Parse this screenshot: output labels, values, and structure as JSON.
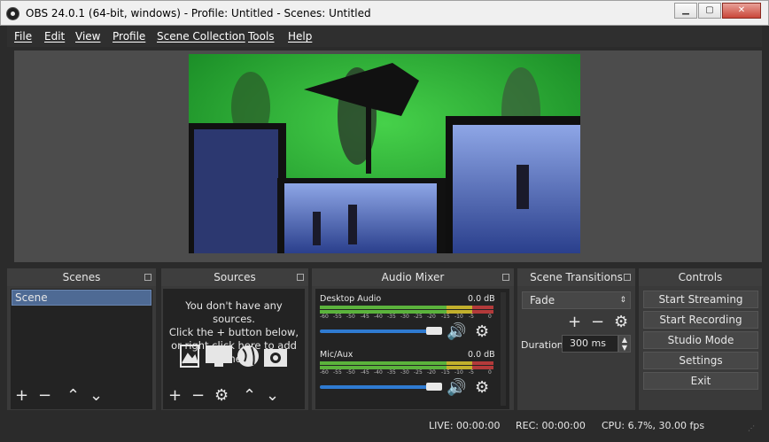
{
  "window": {
    "title": "OBS 24.0.1 (64-bit, windows) - Profile: Untitled - Scenes: Untitled"
  },
  "menu": [
    "File",
    "Edit",
    "View",
    "Profile",
    "Scene Collection",
    "Tools",
    "Help"
  ],
  "docks": {
    "scenes": {
      "title": "Scenes",
      "items": [
        "Scene"
      ]
    },
    "sources": {
      "title": "Sources",
      "empty_text_1": "You don't have any sources.",
      "empty_text_2": "Click the + button below,",
      "empty_text_3": "or right click here to add one."
    },
    "mixer": {
      "title": "Audio Mixer",
      "channels": [
        {
          "name": "Desktop Audio",
          "db": "0.0 dB",
          "volume": 1.0
        },
        {
          "name": "Mic/Aux",
          "db": "0.0 dB",
          "volume": 1.0
        }
      ],
      "ticks": [
        "-60",
        "-55",
        "-50",
        "-45",
        "-40",
        "-35",
        "-30",
        "-25",
        "-20",
        "-15",
        "-10",
        "-5",
        "0"
      ]
    },
    "transitions": {
      "title": "Scene Transitions",
      "selected": "Fade",
      "duration_label": "Duration",
      "duration_value": "300 ms"
    },
    "controls": {
      "title": "Controls",
      "buttons": [
        "Start Streaming",
        "Start Recording",
        "Studio Mode",
        "Settings",
        "Exit"
      ]
    }
  },
  "status": {
    "live": "LIVE: 00:00:00",
    "rec": "REC: 00:00:00",
    "cpu": "CPU: 6.7%, 30.00 fps"
  },
  "colors": {
    "meter_green": "#5bb33c",
    "meter_yellow": "#c2b02c",
    "meter_red": "#b33a3a",
    "accent": "#2f7bd1"
  }
}
